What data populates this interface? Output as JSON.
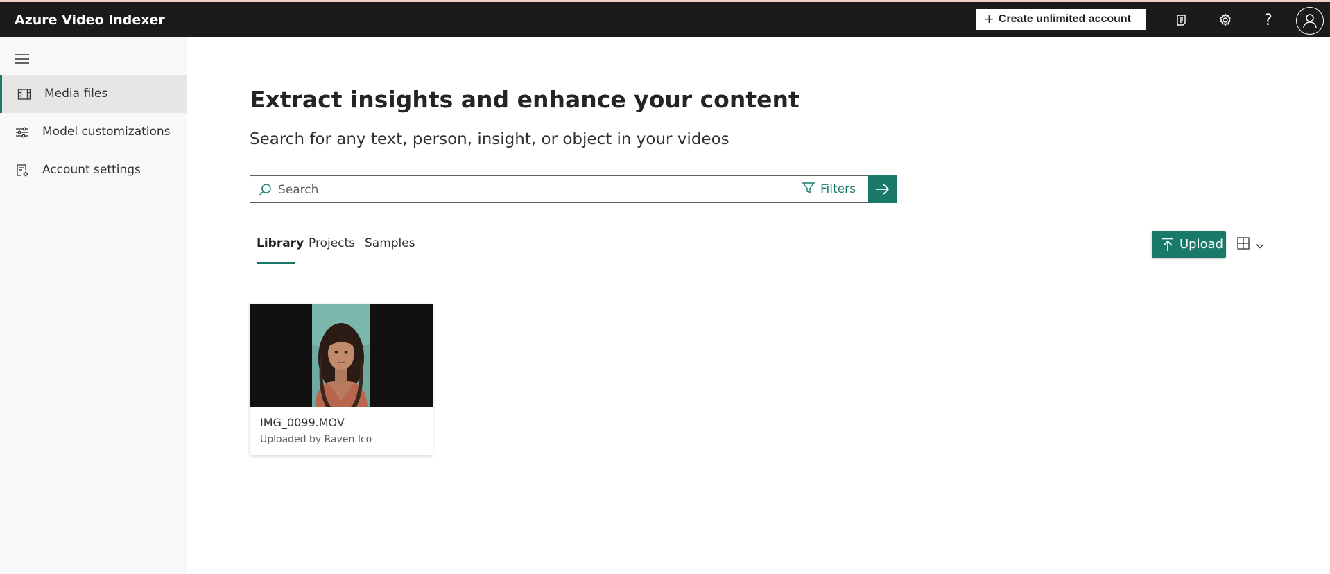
{
  "header": {
    "app_title": "Azure Video Indexer",
    "create_account_label": "Create unlimited account",
    "icons": [
      "whats-new-icon",
      "gear-icon",
      "help-icon",
      "account-avatar-icon"
    ],
    "help_glyph": "?"
  },
  "sidebar": {
    "items": [
      {
        "label": "Media files",
        "icon": "film-icon",
        "active": true
      },
      {
        "label": "Model customizations",
        "icon": "sliders-icon",
        "active": false
      },
      {
        "label": "Account settings",
        "icon": "settings-doc-icon",
        "active": false
      }
    ]
  },
  "main": {
    "title": "Extract insights and enhance your content",
    "subtitle": "Search for any text, person, insight, or object in your videos",
    "search": {
      "placeholder": "Search",
      "value": ""
    },
    "filters_label": "Filters",
    "tabs": [
      {
        "label": "Library",
        "active": true
      },
      {
        "label": "Projects",
        "active": false
      },
      {
        "label": "Samples",
        "active": false
      }
    ],
    "upload_label": "Upload",
    "media": [
      {
        "title": "IMG_0099.MOV",
        "uploaded_by": "Uploaded by Raven Ico"
      }
    ]
  },
  "colors": {
    "accent": "#197a6a",
    "topbar": "#1b1b1b",
    "sidebar_bg": "#f8f8f8"
  }
}
